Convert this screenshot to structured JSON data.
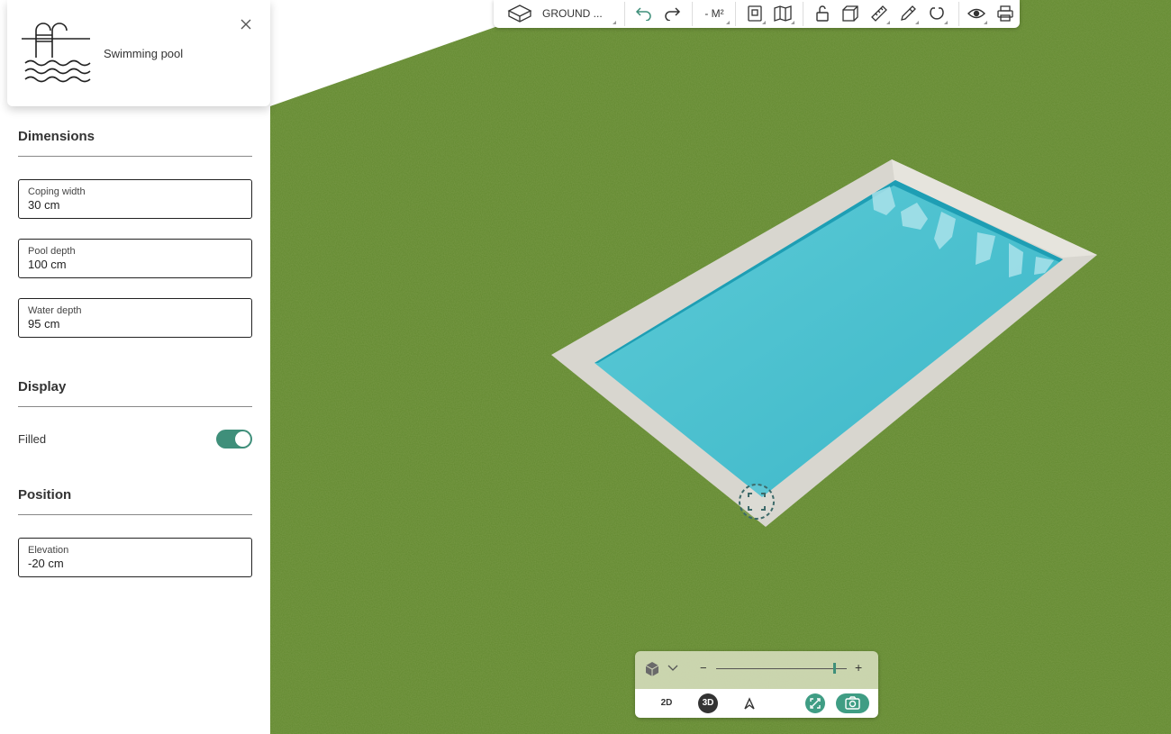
{
  "object_panel": {
    "title": "Swimming pool",
    "icon": "pool-ladder-icon",
    "close_icon": "close-icon"
  },
  "sections": {
    "dimensions": "Dimensions",
    "display": "Display",
    "position": "Position"
  },
  "fields": {
    "coping_width": {
      "label": "Coping width",
      "value": "30 cm"
    },
    "pool_depth": {
      "label": "Pool depth",
      "value": "100 cm"
    },
    "water_depth": {
      "label": "Water depth",
      "value": "95 cm"
    },
    "elevation": {
      "label": "Elevation",
      "value": "-20  cm"
    }
  },
  "display": {
    "filled_label": "Filled",
    "filled": true
  },
  "toolbar": {
    "level_label": "GROUND ...",
    "area_label": "- M²",
    "icons": [
      "cube-outline-icon",
      "undo-icon",
      "redo-icon",
      "floorplan-icon",
      "map-icon",
      "unlock-icon",
      "box-icon",
      "ruler-icon",
      "eyedropper-icon",
      "magnet-icon",
      "eye-icon",
      "print-icon"
    ]
  },
  "view_controls": {
    "mode_2d": "2D",
    "mode_3d": "3D",
    "zoom_minus": "−",
    "zoom_plus": "+",
    "zoom_level": 0.9,
    "active_mode": "3D"
  },
  "colors": {
    "accent": "#3f8f7a",
    "grass": "#5f8a2e",
    "water": "#45bccb",
    "coping": "#d8d6cf"
  }
}
